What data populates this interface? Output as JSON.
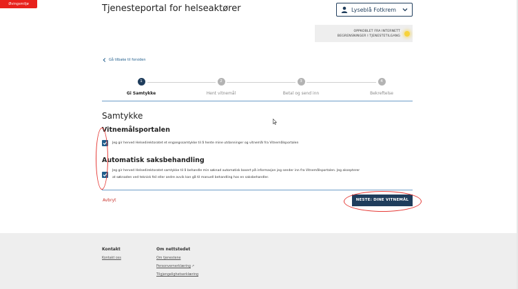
{
  "env_badge": "Øvingsmiljø",
  "header": {
    "title": "Tjenesteportal for helseaktører",
    "user_label": "Lyseblå Fotkrem"
  },
  "connection": {
    "line1": "OPPKOBLET FRA INTERNETT",
    "line2": "BEGRENSNINGER I TJENESTETILGANG"
  },
  "back_link": "Gå tilbake til forsiden",
  "stepper": {
    "steps": [
      {
        "number": "1",
        "label": "Gi Samtykke"
      },
      {
        "number": "2",
        "label": "Hent vitnemål"
      },
      {
        "number": "3",
        "label": "Betal og send inn"
      },
      {
        "number": "4",
        "label": "Bekreftelse"
      }
    ]
  },
  "consent": {
    "title": "Samtykke",
    "section1": {
      "heading": "Vitnemålsportalen",
      "text": "Jeg gir herved Helsedirektoratet et engangssamtykke til å hente mine utdanninger og vitnemål fra Vitnemålsportalen"
    },
    "section2": {
      "heading": "Automatisk saksbehandling",
      "text_line1": "Jeg gir herved Helsedirektoratet samtykke til å behandle min søknad automatisk basert på informasjon jeg sender inn fra Vitnemålsportalen. Jeg aksepterer",
      "text_line2": "at søknaden ved teknisk feil eller andre avvik kan gå til manuell behandling hos en saksbehandler."
    }
  },
  "actions": {
    "cancel": "Avbryt",
    "next": "NESTE: DINE VITNEMÅL"
  },
  "footer": {
    "contact_heading": "Kontakt",
    "contact_link": "Kontakt oss",
    "about_heading": "Om nettstedet",
    "about_links": [
      "Om tjenestene",
      "Personvernerklæring",
      "Tilgjengelighetserklæring"
    ]
  },
  "colors": {
    "primary": "#1f3d5c",
    "link": "#1f5d8c",
    "danger": "#c8322b",
    "badge": "#e8211c",
    "annotation": "#e53935"
  }
}
